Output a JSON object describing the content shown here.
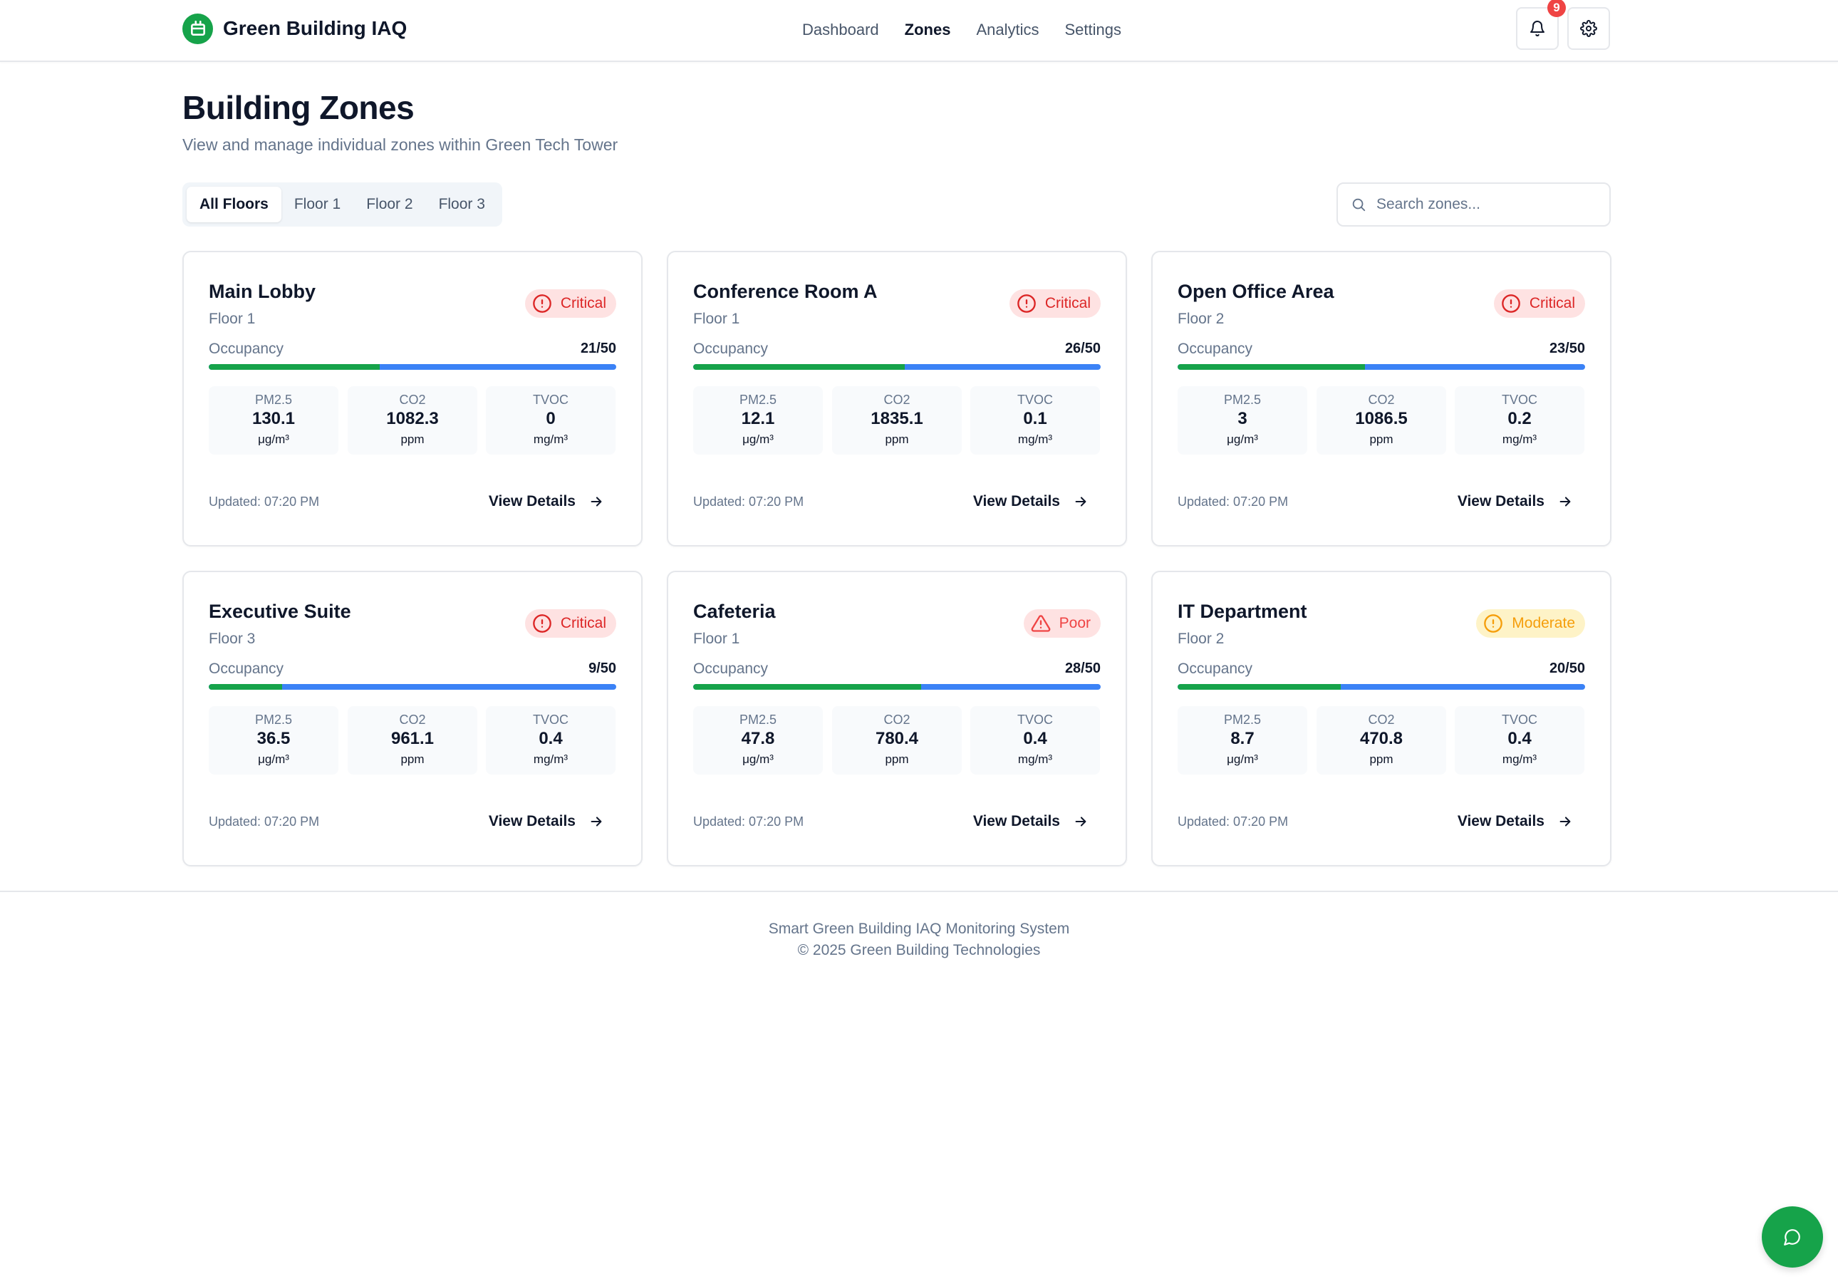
{
  "app": {
    "title": "Green Building IAQ"
  },
  "nav": [
    {
      "label": "Dashboard",
      "active": false
    },
    {
      "label": "Zones",
      "active": true
    },
    {
      "label": "Analytics",
      "active": false
    },
    {
      "label": "Settings",
      "active": false
    }
  ],
  "notifications": {
    "count": "9",
    "icon": "bell-icon"
  },
  "settings_icon": "gear-icon",
  "page": {
    "title": "Building Zones",
    "subtitle": "View and manage individual zones within Green Tech Tower"
  },
  "tabs": [
    {
      "label": "All Floors",
      "active": true
    },
    {
      "label": "Floor 1",
      "active": false
    },
    {
      "label": "Floor 2",
      "active": false
    },
    {
      "label": "Floor 3",
      "active": false
    }
  ],
  "search": {
    "placeholder": "Search zones...",
    "value": ""
  },
  "labels": {
    "occupancy": "Occupancy",
    "view_details": "View Details"
  },
  "colors": {
    "brand": "#16a34a",
    "critical": "#dc2626",
    "poor": "#ef4444",
    "moderate": "#f59e0b",
    "occupancy_fill": "#16a34a",
    "occupancy_track": "#3b82f6"
  },
  "zones": [
    {
      "name": "Main Lobby",
      "floor": "Floor 1",
      "status": "Critical",
      "occupancy": "21/50",
      "occupancy_ratio": 0.42,
      "metrics": [
        {
          "label": "PM2.5",
          "value": "130.1",
          "unit": "μg/m³"
        },
        {
          "label": "CO2",
          "value": "1082.3",
          "unit": "ppm"
        },
        {
          "label": "TVOC",
          "value": "0",
          "unit": "mg/m³"
        }
      ],
      "updated": "Updated: 07:20 PM"
    },
    {
      "name": "Conference Room A",
      "floor": "Floor 1",
      "status": "Critical",
      "occupancy": "26/50",
      "occupancy_ratio": 0.52,
      "metrics": [
        {
          "label": "PM2.5",
          "value": "12.1",
          "unit": "μg/m³"
        },
        {
          "label": "CO2",
          "value": "1835.1",
          "unit": "ppm"
        },
        {
          "label": "TVOC",
          "value": "0.1",
          "unit": "mg/m³"
        }
      ],
      "updated": "Updated: 07:20 PM"
    },
    {
      "name": "Open Office Area",
      "floor": "Floor 2",
      "status": "Critical",
      "occupancy": "23/50",
      "occupancy_ratio": 0.46,
      "metrics": [
        {
          "label": "PM2.5",
          "value": "3",
          "unit": "μg/m³"
        },
        {
          "label": "CO2",
          "value": "1086.5",
          "unit": "ppm"
        },
        {
          "label": "TVOC",
          "value": "0.2",
          "unit": "mg/m³"
        }
      ],
      "updated": "Updated: 07:20 PM"
    },
    {
      "name": "Executive Suite",
      "floor": "Floor 3",
      "status": "Critical",
      "occupancy": "9/50",
      "occupancy_ratio": 0.18,
      "metrics": [
        {
          "label": "PM2.5",
          "value": "36.5",
          "unit": "μg/m³"
        },
        {
          "label": "CO2",
          "value": "961.1",
          "unit": "ppm"
        },
        {
          "label": "TVOC",
          "value": "0.4",
          "unit": "mg/m³"
        }
      ],
      "updated": "Updated: 07:20 PM"
    },
    {
      "name": "Cafeteria",
      "floor": "Floor 1",
      "status": "Poor",
      "occupancy": "28/50",
      "occupancy_ratio": 0.56,
      "metrics": [
        {
          "label": "PM2.5",
          "value": "47.8",
          "unit": "μg/m³"
        },
        {
          "label": "CO2",
          "value": "780.4",
          "unit": "ppm"
        },
        {
          "label": "TVOC",
          "value": "0.4",
          "unit": "mg/m³"
        }
      ],
      "updated": "Updated: 07:20 PM"
    },
    {
      "name": "IT Department",
      "floor": "Floor 2",
      "status": "Moderate",
      "occupancy": "20/50",
      "occupancy_ratio": 0.4,
      "metrics": [
        {
          "label": "PM2.5",
          "value": "8.7",
          "unit": "μg/m³"
        },
        {
          "label": "CO2",
          "value": "470.8",
          "unit": "ppm"
        },
        {
          "label": "TVOC",
          "value": "0.4",
          "unit": "mg/m³"
        }
      ],
      "updated": "Updated: 07:20 PM"
    }
  ],
  "footer": {
    "line1": "Smart Green Building IAQ Monitoring System",
    "line2": "© 2025 Green Building Technologies"
  },
  "chat": {
    "icon": "chat-bubble-icon"
  }
}
